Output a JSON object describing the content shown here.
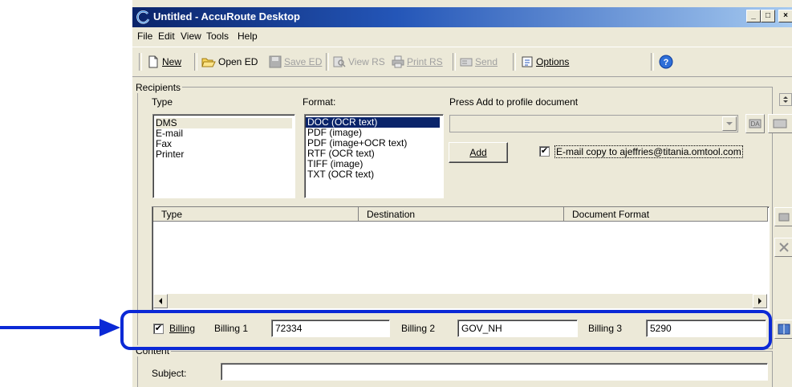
{
  "window": {
    "title": "Untitled - AccuRoute Desktop",
    "caption_buttons": {
      "minimize": "_",
      "maximize": "□",
      "close": "×"
    }
  },
  "menu": [
    "File",
    "Edit",
    "View",
    "Tools",
    "Help"
  ],
  "toolbar": {
    "new_label": "New",
    "open_label": "Open ED",
    "save_label": "Save ED",
    "view_label": "View RS",
    "print_label": "Print RS",
    "send_label": "Send",
    "options_label": "Options"
  },
  "recipients": {
    "group_label": "Recipients",
    "type_label": "Type",
    "types": [
      "DMS",
      "E-mail",
      "Fax",
      "Printer"
    ],
    "selected_type": "DMS",
    "format_label": "Format:",
    "formats": [
      "DOC (OCR text)",
      "PDF (image)",
      "PDF (image+OCR text)",
      "RTF (OCR text)",
      "TIFF (image)",
      "TXT (OCR text)"
    ],
    "selected_format": "DOC (OCR text)",
    "profile_label": "Press Add to profile document",
    "profile_value": "",
    "add_label": "Add",
    "email_copy_label": "E-mail copy to ajeffries@titania.omtool.com",
    "email_copy_checked": true,
    "table_headers": [
      "Type",
      "Destination",
      "Document Format"
    ],
    "table_rows": []
  },
  "billing": {
    "checkbox_label": "Billing",
    "checked": true,
    "billing1_label": "Billing 1",
    "billing1_value": "72334",
    "billing2_label": "Billing 2",
    "billing2_value": "GOV_NH",
    "billing3_label": "Billing 3",
    "billing3_value": "5290"
  },
  "content": {
    "group_label": "Content",
    "subject_label": "Subject:",
    "subject_value": ""
  },
  "annotation": {
    "highlight_color": "#0b29d6"
  }
}
